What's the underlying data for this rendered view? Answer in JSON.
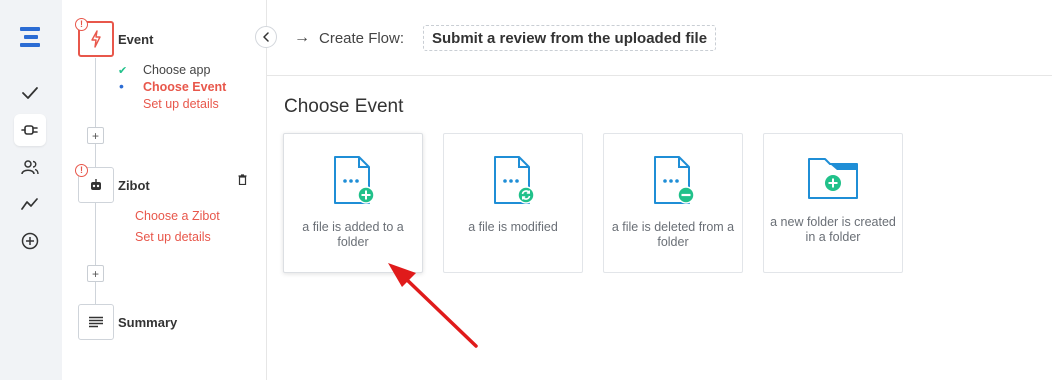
{
  "header": {
    "arrow_glyph": "→",
    "label": "Create Flow:",
    "flow_name": "Submit a review from the uploaded file"
  },
  "rail": {
    "items": [
      {
        "icon": "app-logo-icon"
      },
      {
        "icon": "check-icon"
      },
      {
        "icon": "plug-icon",
        "active": true
      },
      {
        "icon": "users-icon"
      },
      {
        "icon": "activity-icon"
      },
      {
        "icon": "plus-circle-icon"
      }
    ]
  },
  "steps": {
    "event": {
      "title": "Event",
      "subs": [
        {
          "label": "Choose app",
          "state": "done",
          "bullet": "✔"
        },
        {
          "label": "Choose Event",
          "state": "current",
          "bullet": "•"
        },
        {
          "label": "Set up details",
          "state": "todo"
        }
      ]
    },
    "zibot": {
      "title": "Zibot",
      "subs": [
        {
          "label": "Choose a Zibot",
          "state": "todo"
        },
        {
          "label": "Set up details",
          "state": "todo"
        }
      ]
    },
    "summary": {
      "title": "Summary"
    },
    "warn_glyph": "!",
    "plus_glyph": "+"
  },
  "main": {
    "title": "Choose Event",
    "cards": [
      {
        "label": "a file is added to a folder",
        "icon": "file-add-icon"
      },
      {
        "label": "a file is modified",
        "icon": "file-sync-icon"
      },
      {
        "label": "a file is deleted from a folder",
        "icon": "file-remove-icon"
      },
      {
        "label": "a new folder is created in a folder",
        "icon": "folder-add-icon"
      }
    ]
  },
  "colors": {
    "accent_red": "#e8574b",
    "icon_blue": "#1f8ed6",
    "icon_green": "#21c18a",
    "brand_blue": "#2b6cd4",
    "arrow_red": "#e01b1b"
  }
}
